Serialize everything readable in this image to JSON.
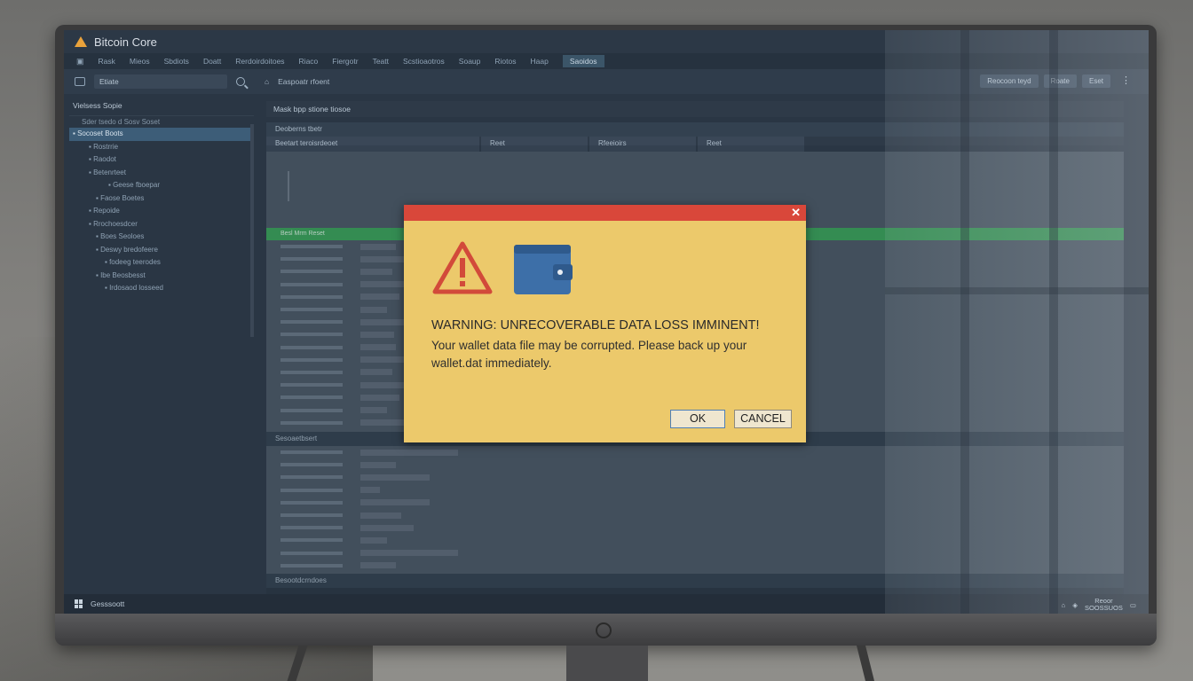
{
  "app": {
    "title": "Bitcoin Core"
  },
  "menubar": {
    "items": [
      "Rask",
      "Mieos",
      "Sbdiots",
      "Doatt",
      "Rerdoirdoitoes",
      "Riaco",
      "Fiergotr",
      "Teatt",
      "Scstioaotros",
      "Soaup",
      "Riotos",
      "Haap",
      "Saoidos"
    ]
  },
  "toolbar": {
    "search_value": "Etiate",
    "path_label": "Easpoatr rfoent",
    "right_buttons": [
      "Reocoon teyd",
      "Roate",
      "Eset"
    ]
  },
  "sidebar": {
    "header": "Vielsess Sopie",
    "subheader": "Sder tsedo d Sosv Soset",
    "items": [
      {
        "label": "Socoset Boots",
        "selected": true
      },
      {
        "label": "Rostrrie",
        "selected": false
      },
      {
        "label": "Raodot",
        "selected": false
      },
      {
        "label": "Betenrteet",
        "selected": false
      },
      {
        "label": "Geese fboepar",
        "selected": false
      },
      {
        "label": "Faose Boetes",
        "selected": false
      },
      {
        "label": "Repoide",
        "selected": false
      },
      {
        "label": "Rrochoesdcer",
        "selected": false
      },
      {
        "label": "Boes Seoloes",
        "selected": false
      },
      {
        "label": "Deswy bredofeere",
        "selected": false
      },
      {
        "label": "fodeeg teerodes",
        "selected": false
      },
      {
        "label": "Ibe Beosbesst",
        "selected": false
      },
      {
        "label": "Irdosaod losseed",
        "selected": false
      }
    ]
  },
  "main": {
    "panel_title": "Mask bpp stione tiosoe",
    "section_top": "Deoberns tbetr",
    "tabs": [
      "Beetart teroisrdeoet",
      "Reet",
      "Rfeeioirs",
      "Reet"
    ],
    "green_row": "Besl Mrm Reset",
    "section_mid": "Sesoaetbsert",
    "section_bottom": "Besootdcrndoes"
  },
  "statusbar": {
    "label": "Gesssoott",
    "tray_time": "Reoor\nSOOSSUOS"
  },
  "dialog": {
    "headline": "WARNING: UNRECOVERABLE DATA LOSS IMMINENT!",
    "message": "Your wallet data file may be corrupted. Please back up your wallet.dat immediately.",
    "ok_label": "OK",
    "cancel_label": "CANCEL",
    "close_glyph": "✕",
    "icons": [
      "warning-triangle",
      "wallet"
    ],
    "colors": {
      "title_bar": "#d9473a",
      "body": "#ecc96b",
      "ok_border": "#4f7fb6"
    }
  }
}
